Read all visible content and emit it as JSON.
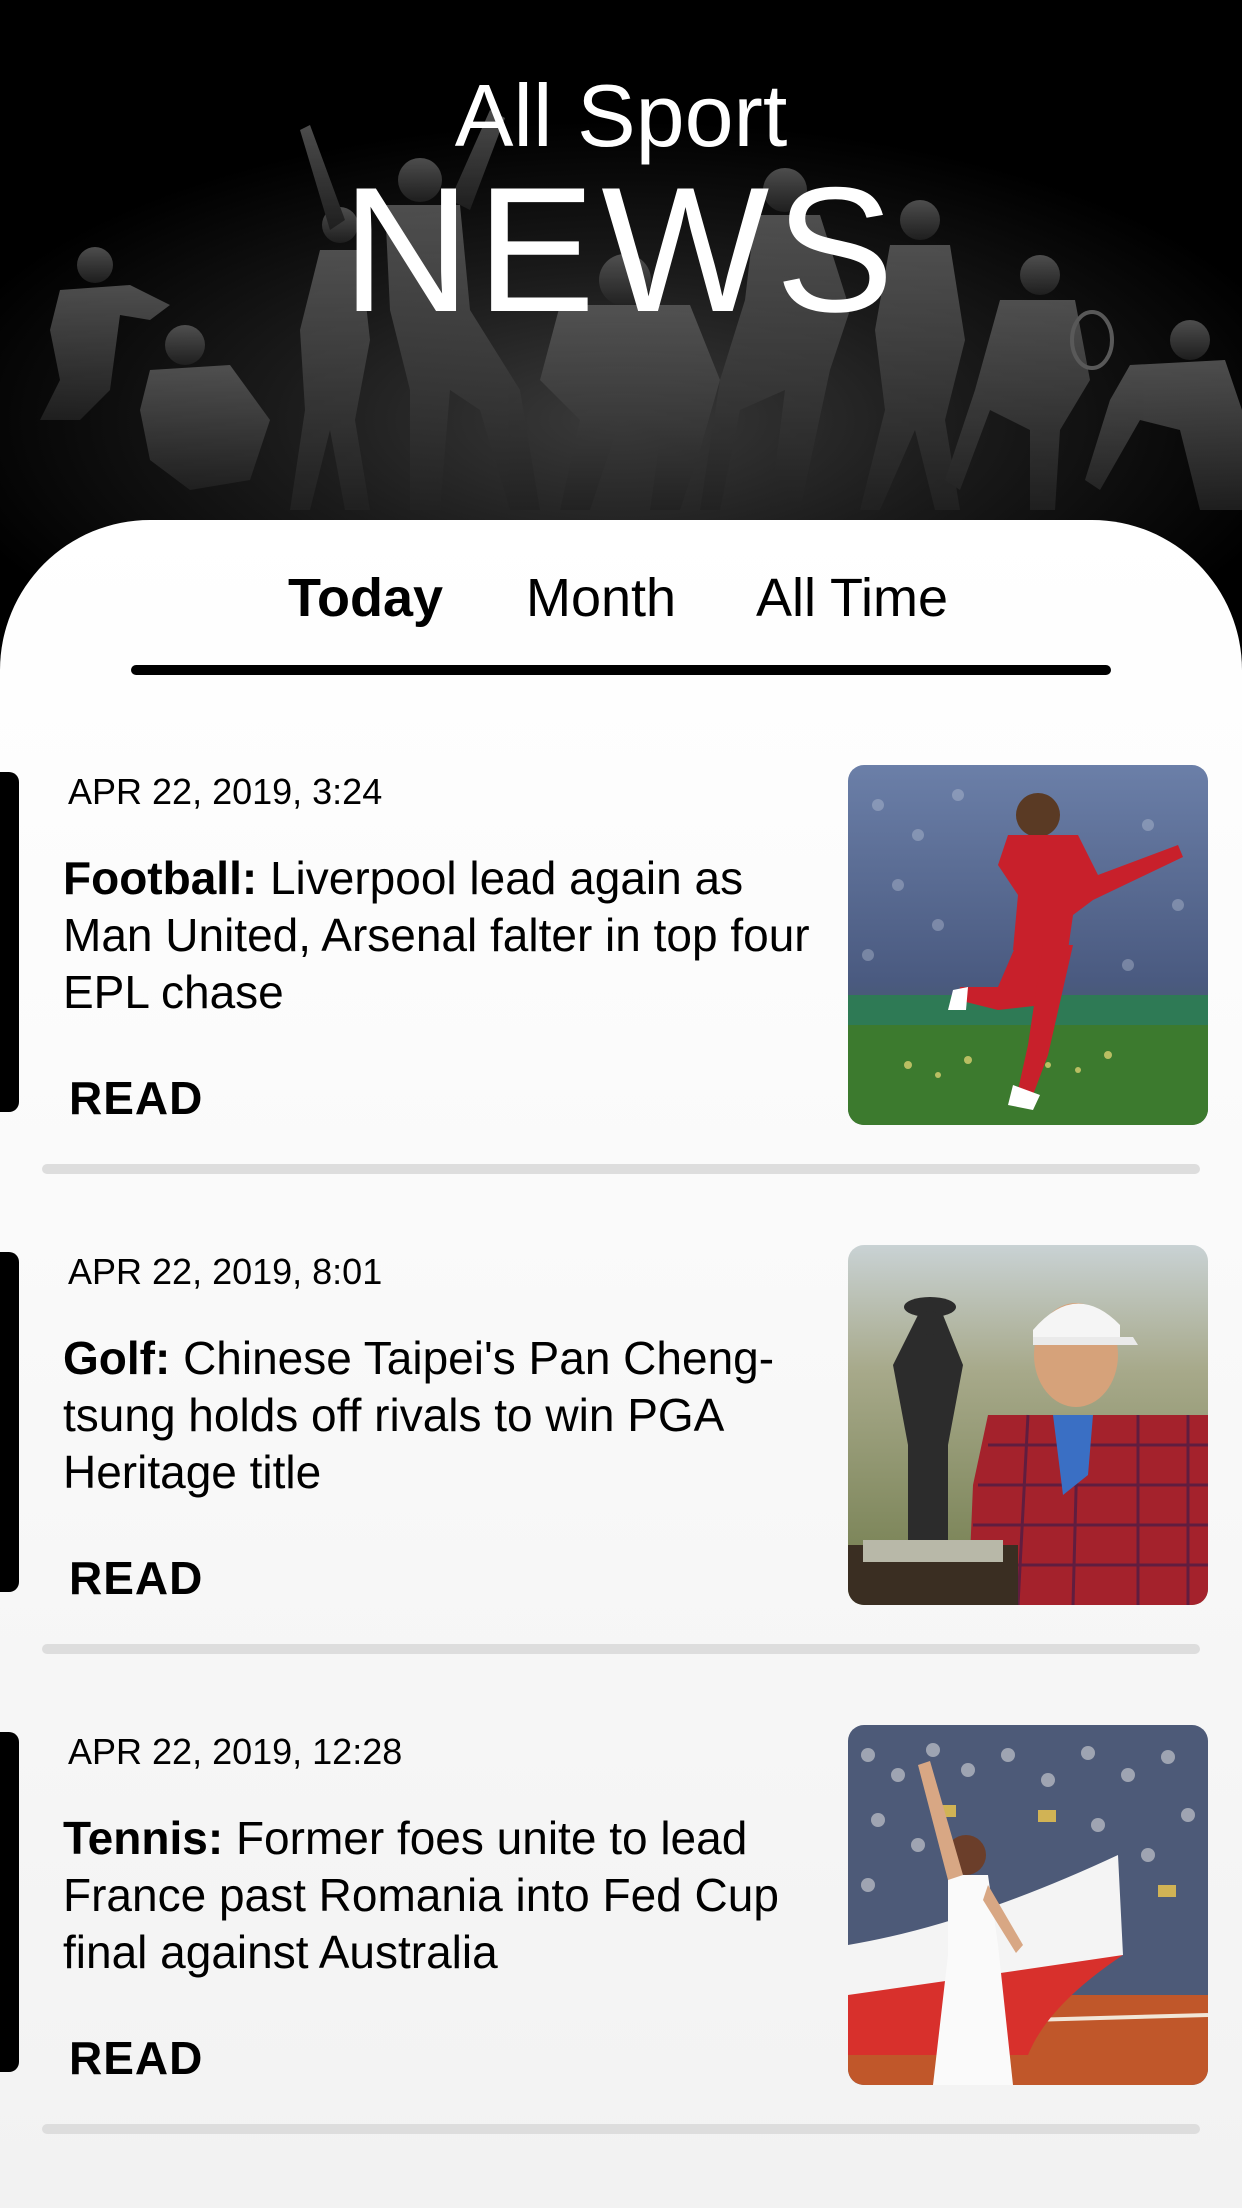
{
  "header": {
    "title_small": "All Sport",
    "title_big": "NEWS"
  },
  "tabs": [
    {
      "label": "Today",
      "active": true
    },
    {
      "label": "Month",
      "active": false
    },
    {
      "label": "All Time",
      "active": false
    }
  ],
  "articles": [
    {
      "date": "APR 22, 2019, 3:24",
      "category": "Football:",
      "headline": "Liverpool lead again as Man United, Arsenal falter in top four EPL chase",
      "read_label": "READ",
      "image_icon": "football-player-photo"
    },
    {
      "date": "APR 22, 2019, 8:01",
      "category": "Golf:",
      "headline": "Chinese Taipei's Pan Cheng-tsung holds off rivals to win PGA Heritage title",
      "read_label": "READ",
      "image_icon": "golfer-trophy-photo"
    },
    {
      "date": "APR 22, 2019, 12:28",
      "category": "Tennis:",
      "headline": "Former foes unite to lead France past Romania into Fed Cup final against Australia",
      "read_label": "READ",
      "image_icon": "tennis-player-flag-photo"
    }
  ],
  "colors": {
    "background": "#000000",
    "sheet": "#ffffff",
    "text": "#000000",
    "divider": "#dddddd"
  }
}
